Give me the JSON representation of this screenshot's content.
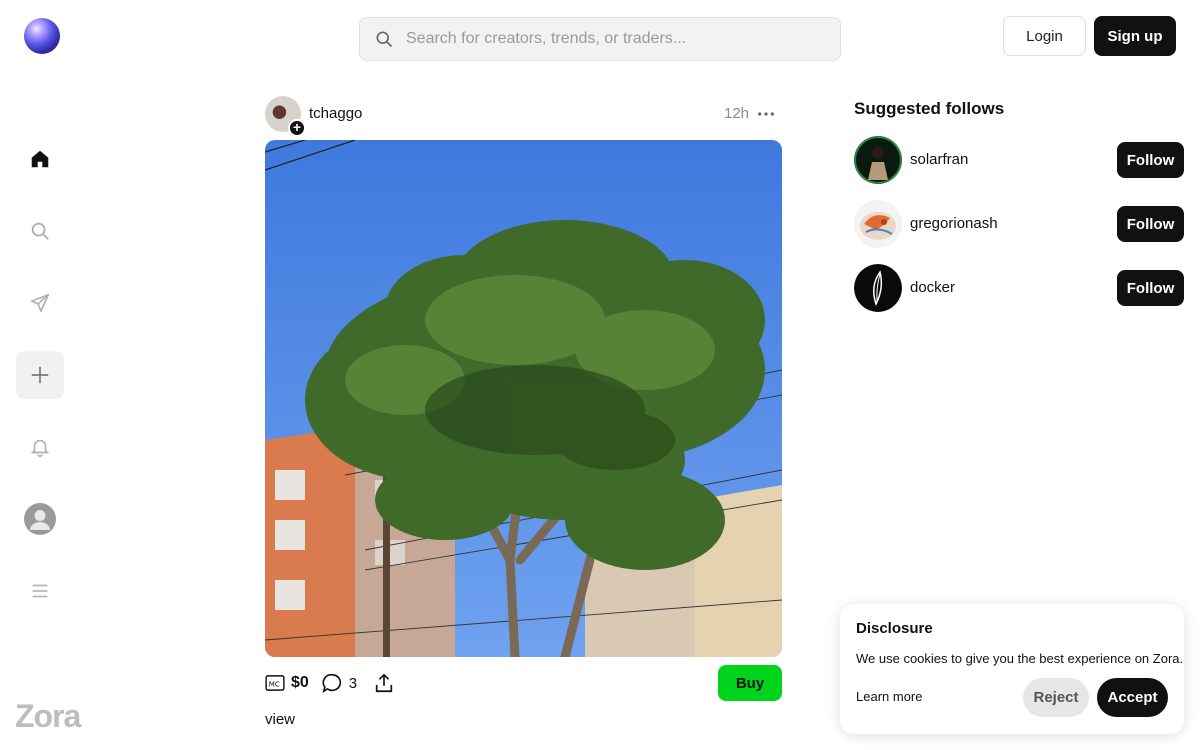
{
  "header": {
    "search_placeholder": "Search for creators, trends, or traders...",
    "login_label": "Login",
    "signup_label": "Sign up"
  },
  "sidebar": {
    "items": [
      {
        "icon": "home-icon",
        "active": true
      },
      {
        "icon": "search-icon"
      },
      {
        "icon": "send-icon"
      },
      {
        "icon": "plus-icon"
      },
      {
        "icon": "bell-icon"
      },
      {
        "icon": "avatar"
      },
      {
        "icon": "menu-icon"
      }
    ],
    "wordmark": "Zora"
  },
  "post": {
    "username": "tchaggo",
    "time": "12h",
    "market_cap": "$0",
    "comments": "3",
    "buy_label": "Buy",
    "caption": "view"
  },
  "suggested": {
    "title": "Suggested follows",
    "follow_label": "Follow",
    "users": [
      {
        "name": "solarfran"
      },
      {
        "name": "gregorionash"
      },
      {
        "name": "docker"
      }
    ]
  },
  "disclosure": {
    "title": "Disclosure",
    "text": "We use cookies to give you the best experience on Zora.",
    "learn_more": "Learn more",
    "reject_label": "Reject",
    "accept_label": "Accept"
  },
  "colors": {
    "buy_green": "#00d41c",
    "primary_dark": "#111111",
    "sky_blue": "#4a86e6"
  }
}
